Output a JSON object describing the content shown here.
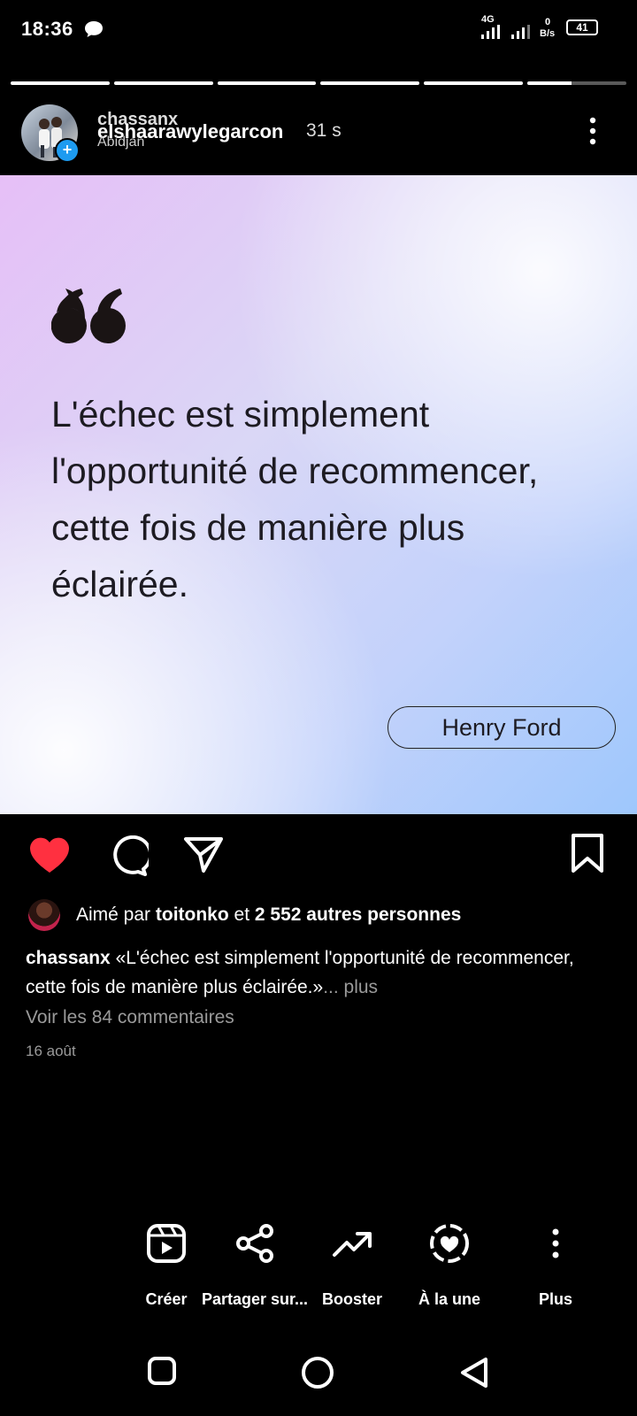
{
  "status_bar": {
    "time": "18:36",
    "network": "4G",
    "speed_value": "0",
    "speed_unit": "B/s",
    "battery": "41"
  },
  "story": {
    "segment_count": 6,
    "progress": [
      1,
      1,
      1,
      1,
      1,
      0.45
    ],
    "username_top": "chassanx",
    "username_main": "elshaarawylegarcon",
    "location": "Abidjan",
    "time_ago": "31 s"
  },
  "quote": {
    "text": "L'échec est simplement l'opportunité de recommencer, cette fois de manière plus éclairée.",
    "author": "Henry Ford"
  },
  "post": {
    "liked_prefix": "Aimé par ",
    "liked_user": "toitonko",
    "liked_and": " et ",
    "liked_others": "2 552 autres personnes",
    "caption_user": "chassanx",
    "caption_text": " «L'échec est simplement l'opportunité de recommencer, cette fois de manière plus éclairée.»",
    "caption_more": "... plus",
    "comments_link": "Voir les 84 commentaires",
    "date": "16 août"
  },
  "bottom_actions": {
    "create": "Créer",
    "share": "Partager sur...",
    "boost": "Booster",
    "highlight": "À la une",
    "more": "Plus"
  },
  "colors": {
    "like": "#ff3040",
    "plus_badge": "#1d9bf0",
    "muted_text": "#9a9a9a"
  }
}
